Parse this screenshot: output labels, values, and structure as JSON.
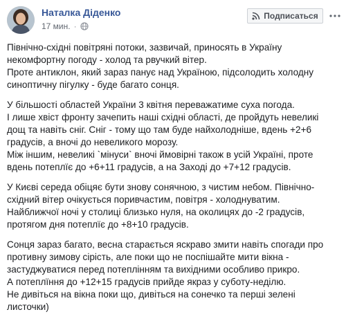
{
  "post": {
    "author": "Наталка Діденко",
    "timestamp": "17 мин.",
    "separator": "·",
    "privacy_icon": "globe-icon",
    "subscribe_icon": "rss-icon",
    "subscribe_label": "Подписаться",
    "more_icon": "more-dots-icon",
    "paragraphs": [
      [
        "Північно-східні повітряні потоки, зазвичай, приносять в Україну",
        "некомфортну погоду - холод та рвучкий вітер.",
        "Проте антиклон, який зараз панує над Україною, підсолодить холодну",
        "синоптичну пігулку - буде багато сонця."
      ],
      [
        "У більшості областей України 3 квітня переважатиме суха погода.",
        "І лише хвіст фронту зачепить наші східні області, де пройдуть невеликі",
        "дощ та навіть сніг. Сніг - тому що там буде найхолодніше, вдень +2+6",
        "градусів, а вночі до невеликого морозу.",
        "Між іншим, невеликі `мінуси` вночі ймовірні також в усій Україні, проте",
        "вдень потеплїє до +6+11 градусів, а на Заході до +7+12 градусів."
      ],
      [
        "У Києві середа обіцяє бути знову сонячною, з чистим небом. Північно-",
        "східний вітер очікується поривчастим, повітря - холоднуватим.",
        "Найближчої ночі у столиці близько нуля, на околицях до -2 градусів,",
        "протягом дня потеплїє до +8+10 градусів."
      ],
      [
        "Сонця зараз багато, весна старається яскраво змити навіть спогади про",
        "противну зимову сірість, але поки що не поспішайте мити вікна -",
        "застуджуватися перед потеплінням та вихідними особливо прикро.",
        "А потеплїння до +12+15 градусів прийде якраз у суботу-неділю.",
        "Не дивіться на вікна поки що, дивіться на сонечко та перші зелені",
        "листочки)"
      ]
    ]
  }
}
